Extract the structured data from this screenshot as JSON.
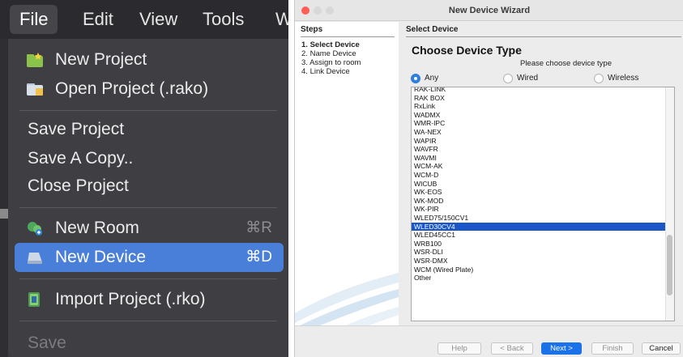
{
  "menubar": {
    "items": [
      {
        "label": "File",
        "active": true
      },
      {
        "label": "Edit"
      },
      {
        "label": "View"
      },
      {
        "label": "Tools"
      },
      {
        "label": "W"
      }
    ]
  },
  "file_menu": {
    "new_project": "New Project",
    "open_project": "Open Project (.rako)",
    "save_project": "Save Project",
    "save_a_copy": "Save A Copy..",
    "close_project": "Close Project",
    "new_room": "New Room",
    "new_room_shortcut": "⌘R",
    "new_device": "New Device",
    "new_device_shortcut": "⌘D",
    "import_project": "Import Project (.rko)",
    "save": "Save",
    "icons": {
      "new_project": "new-project-icon",
      "open_project": "folder-icon",
      "new_room": "room-icon",
      "new_device": "device-icon",
      "import_project": "import-icon"
    },
    "highlight_color": "#4a7fd9"
  },
  "wizard": {
    "title": "New Device Wizard",
    "steps_title": "Steps",
    "steps": [
      {
        "num": "1.",
        "label": "Select Device",
        "current": true
      },
      {
        "num": "2.",
        "label": "Name Device"
      },
      {
        "num": "3.",
        "label": "Assign to room"
      },
      {
        "num": "4.",
        "label": "Link Device"
      }
    ],
    "section_header": "Select Device",
    "heading": "Choose Device Type",
    "subheading": "Please choose device type",
    "filters": [
      {
        "label": "Any",
        "checked": true
      },
      {
        "label": "Wired",
        "checked": false
      },
      {
        "label": "Wireless",
        "checked": false
      }
    ],
    "devices": [
      "RAK-LINK",
      "RAK BOX",
      "RxLink",
      "WADMX",
      "WMR-IPC",
      "WA-NEX",
      "WAPIR",
      "WAVFR",
      "WAVMI",
      "WCM-AK",
      "WCM-D",
      "WICUB",
      "WK-EOS",
      "WK-MOD",
      "WK-PIR",
      "WLED75/150CV1",
      "WLED30CV4",
      "WLED45CC1",
      "WRB100",
      "WSR-DLI",
      "WSR-DMX",
      "WCM (Wired Plate)",
      "Other"
    ],
    "selected_device": "WLED30CV4",
    "buttons": {
      "help": "Help",
      "back": "< Back",
      "next": "Next >",
      "finish": "Finish",
      "cancel": "Cancel"
    },
    "accent_color": "#1b72e8"
  }
}
